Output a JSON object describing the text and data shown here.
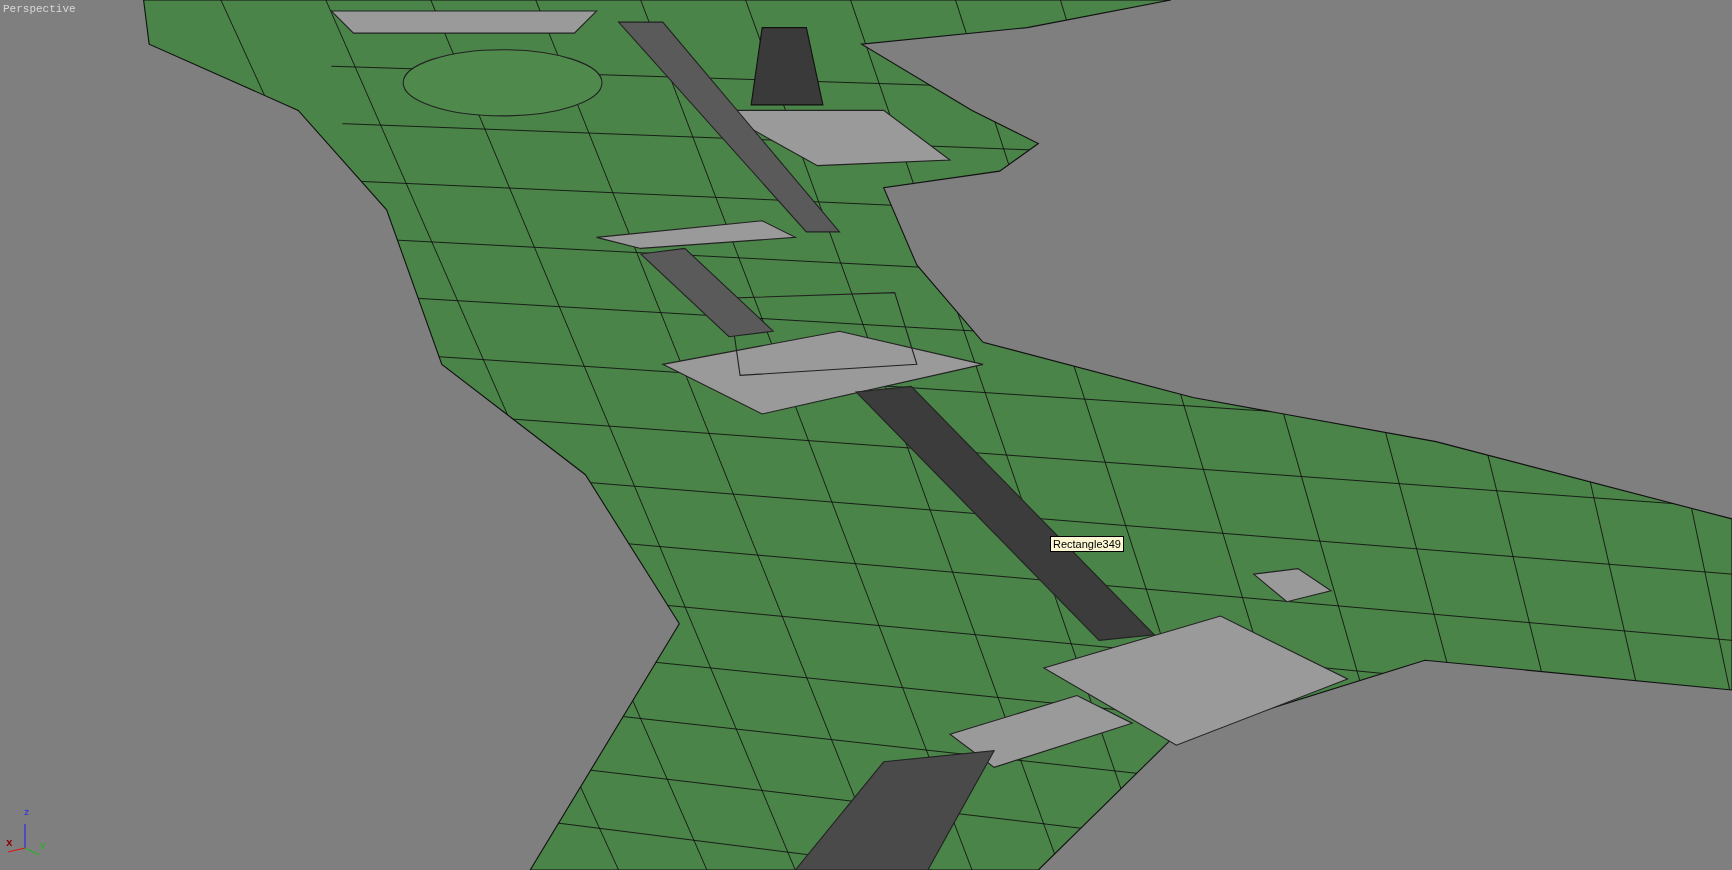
{
  "viewport": {
    "label": "Perspective"
  },
  "tooltip": {
    "text": "Rectangle349"
  },
  "axis_gizmo": {
    "x": "x",
    "y": "y",
    "z": "z"
  }
}
